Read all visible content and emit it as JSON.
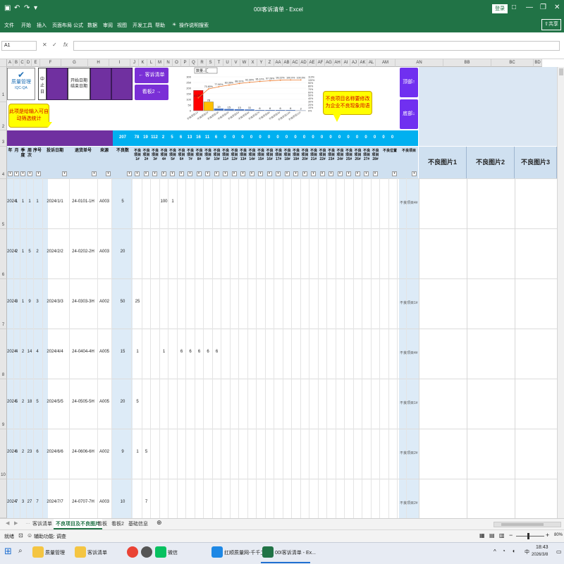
{
  "window": {
    "title": "00I客诉清单 - Excel",
    "login": "登录",
    "controls": [
      "□",
      "—",
      "❐",
      "✕"
    ]
  },
  "ribbon": {
    "tabs": [
      "文件",
      "开始",
      "插入",
      "页面布局",
      "公式",
      "数据",
      "审阅",
      "视图",
      "开发工具",
      "帮助"
    ],
    "tell_me": "操作说明搜索",
    "share": "共享"
  },
  "formula_bar": {
    "name_box": "A1",
    "fx": "fx",
    "value": ""
  },
  "columns": [
    "A",
    "B",
    "C",
    "D",
    "E",
    "F",
    "G",
    "H",
    "I",
    "J",
    "K",
    "L",
    "M",
    "N",
    "O",
    "P",
    "Q",
    "R",
    "S",
    "T",
    "U",
    "V",
    "W",
    "X",
    "Y",
    "Z",
    "AA",
    "AB",
    "AC",
    "AD",
    "AE",
    "AF",
    "AG",
    "AH",
    "AI",
    "AJ",
    "AK",
    "AL",
    "AM",
    "AN",
    "BB",
    "BC",
    "BD"
  ],
  "rows": [
    "1",
    "2",
    "3",
    "4",
    "5",
    "6",
    "7",
    "8",
    "9",
    "10"
  ],
  "top": {
    "logo": "质量管理",
    "logo_sub": "IQC-QA",
    "filter_label": "开始日期\n结束日期",
    "filter_label2": "开始日期\n结束日期",
    "btn_complaints": "← 客诉清单",
    "btn_board": "看板2 →",
    "btn_top": "顶部↑",
    "btn_bottom": "底部↓",
    "callout_left": "此项是给输入可自动筛选统计",
    "callout_right": "不良项目名称要修改为企业不良现象用语"
  },
  "chart_data": {
    "type": "bar",
    "dropdown": "数量↓汇",
    "categories": [
      "不良项目1#",
      "不良项目2#",
      "不良项目3#",
      "不良项目4#",
      "不良项目5#",
      "不良项目6#",
      "不良项目7#",
      "不良项目8#",
      "不良项目9#",
      "不良项目10#",
      "不良项目11#"
    ],
    "series": [
      {
        "values": [
          180,
          78,
          19,
          15,
          13,
          11,
          6,
          6,
          6,
          6,
          2
        ]
      },
      {
        "values": [
          41.76,
          70.8,
          77.9,
          83.36,
          88.31,
          92.3,
          95.12,
          97.28,
          99.22,
          100.0,
          100.0
        ]
      }
    ],
    "pct_labels": [
      "41.76%",
      "70.80%",
      "77.90%",
      "83.36%",
      "88.31%",
      "92.30%",
      "95.12%",
      "97.28%",
      "99.22%",
      "100.0%",
      "100.0%"
    ],
    "bar_labels": [
      "",
      "78",
      "19",
      "15",
      "13",
      "11",
      "6",
      "6",
      "6",
      "6",
      "2"
    ],
    "y_ticks": [
      "0",
      "50",
      "100",
      "150",
      "200",
      "250",
      "300"
    ],
    "y2_ticks": [
      "0%",
      "10%",
      "20%",
      "30%",
      "40%",
      "50%",
      "60%",
      "70%",
      "80%",
      "90%",
      "100%",
      "110%"
    ],
    "ylim": [
      0,
      300
    ],
    "y2lim": [
      0,
      110
    ],
    "colors": [
      "#ff0000",
      "#ffc000",
      "#4472c4",
      "#ed7d31"
    ]
  },
  "counts_bar": [
    "207",
    "78",
    "19",
    "112",
    "2",
    "5",
    "6",
    "13",
    "16",
    "11",
    "6",
    "0",
    "0",
    "0",
    "0",
    "0",
    "0",
    "0",
    "0",
    "0",
    "0",
    "0",
    "0",
    "0",
    "0",
    "0",
    "0",
    "0",
    "0",
    "0",
    "0"
  ],
  "headers": {
    "fixed": [
      "年",
      "月",
      "季度",
      "周次",
      "序号",
      "投诉日期",
      "退货单号",
      "来源",
      "不良数"
    ],
    "defects": [
      "不良项目1#",
      "不良项目2#",
      "不良项目3#",
      "不良项目4#",
      "不良项目5#",
      "不良项目6#",
      "不良项目7#",
      "不良项目8#",
      "不良项目9#",
      "不良项目10#",
      "不良项目11#",
      "不良项目12#",
      "不良项目13#",
      "不良项目14#",
      "不良项目15#",
      "不良项目16#",
      "不良项目17#",
      "不良项目18#",
      "不良项目19#",
      "不良项目20#",
      "不良项目21#",
      "不良项目22#",
      "不良项目23#",
      "不良项目24#",
      "不良项目25#",
      "不良项目26#",
      "不良项目27#",
      "不良项目28#"
    ],
    "defect_position": "不良位置",
    "defect_item": "不良项目",
    "pictures": [
      "不良图片1",
      "不良图片2",
      "不良图片3"
    ]
  },
  "data_rows": [
    {
      "y": "2024",
      "m": "1",
      "q": "1",
      "w": "1",
      "no": "1",
      "date": "2024/1/1",
      "ret": "24-0101-1H",
      "src": "A003",
      "qty": "5",
      "vals": {
        "3": "100",
        "4": "1"
      },
      "note": "不良项目4#"
    },
    {
      "y": "2024",
      "m": "2",
      "q": "1",
      "w": "5",
      "no": "2",
      "date": "2024/2/2",
      "ret": "24-0202-2H",
      "src": "A003",
      "qty": "20",
      "vals": {},
      "note": ""
    },
    {
      "y": "2024",
      "m": "3",
      "q": "1",
      "w": "9",
      "no": "3",
      "date": "2024/3/3",
      "ret": "24-0303-3H",
      "src": "A002",
      "qty": "50",
      "vals": {
        "0": "25"
      },
      "note": "不良项目1#"
    },
    {
      "y": "2024",
      "m": "4",
      "q": "2",
      "w": "14",
      "no": "4",
      "date": "2024/4/4",
      "ret": "24-0404-4H",
      "src": "A005",
      "qty": "15",
      "vals": {
        "0": "1",
        "3": "1",
        "5": "6",
        "6": "6",
        "7": "6",
        "8": "6",
        "9": "6"
      },
      "note": "不良项目4#"
    },
    {
      "y": "2024",
      "m": "5",
      "q": "2",
      "w": "18",
      "no": "5",
      "date": "2024/5/5",
      "ret": "24-0505-5H",
      "src": "A005",
      "qty": "20",
      "vals": {
        "0": "5"
      },
      "note": "不良项目1#"
    },
    {
      "y": "2024",
      "m": "6",
      "q": "2",
      "w": "23",
      "no": "6",
      "date": "2024/6/6",
      "ret": "24-0606-6H",
      "src": "A002",
      "qty": "9",
      "vals": {
        "0": "1",
        "1": "5"
      },
      "note": "不良项目2#"
    },
    {
      "y": "2024",
      "m": "7",
      "q": "3",
      "w": "27",
      "no": "7",
      "date": "2024/7/7",
      "ret": "24-0707-7H",
      "src": "A003",
      "qty": "10",
      "vals": {
        "1": "7"
      },
      "note": "不良项目2#"
    }
  ],
  "sheet_tabs": [
    "客诉清单",
    "不良项目及不良图片",
    "看板",
    "看板2",
    "基础信息"
  ],
  "status": {
    "ready": "就绪",
    "accessibility": "辅助功能: 调查",
    "zoom": "80%"
  },
  "taskbar": {
    "apps": [
      "质量管理",
      "客诉清单",
      "微信",
      "扛顺质量网-千千工...",
      "00I客诉清单 - Ex..."
    ],
    "time": "18:43",
    "date": "2026/3/8",
    "ime": "中"
  }
}
